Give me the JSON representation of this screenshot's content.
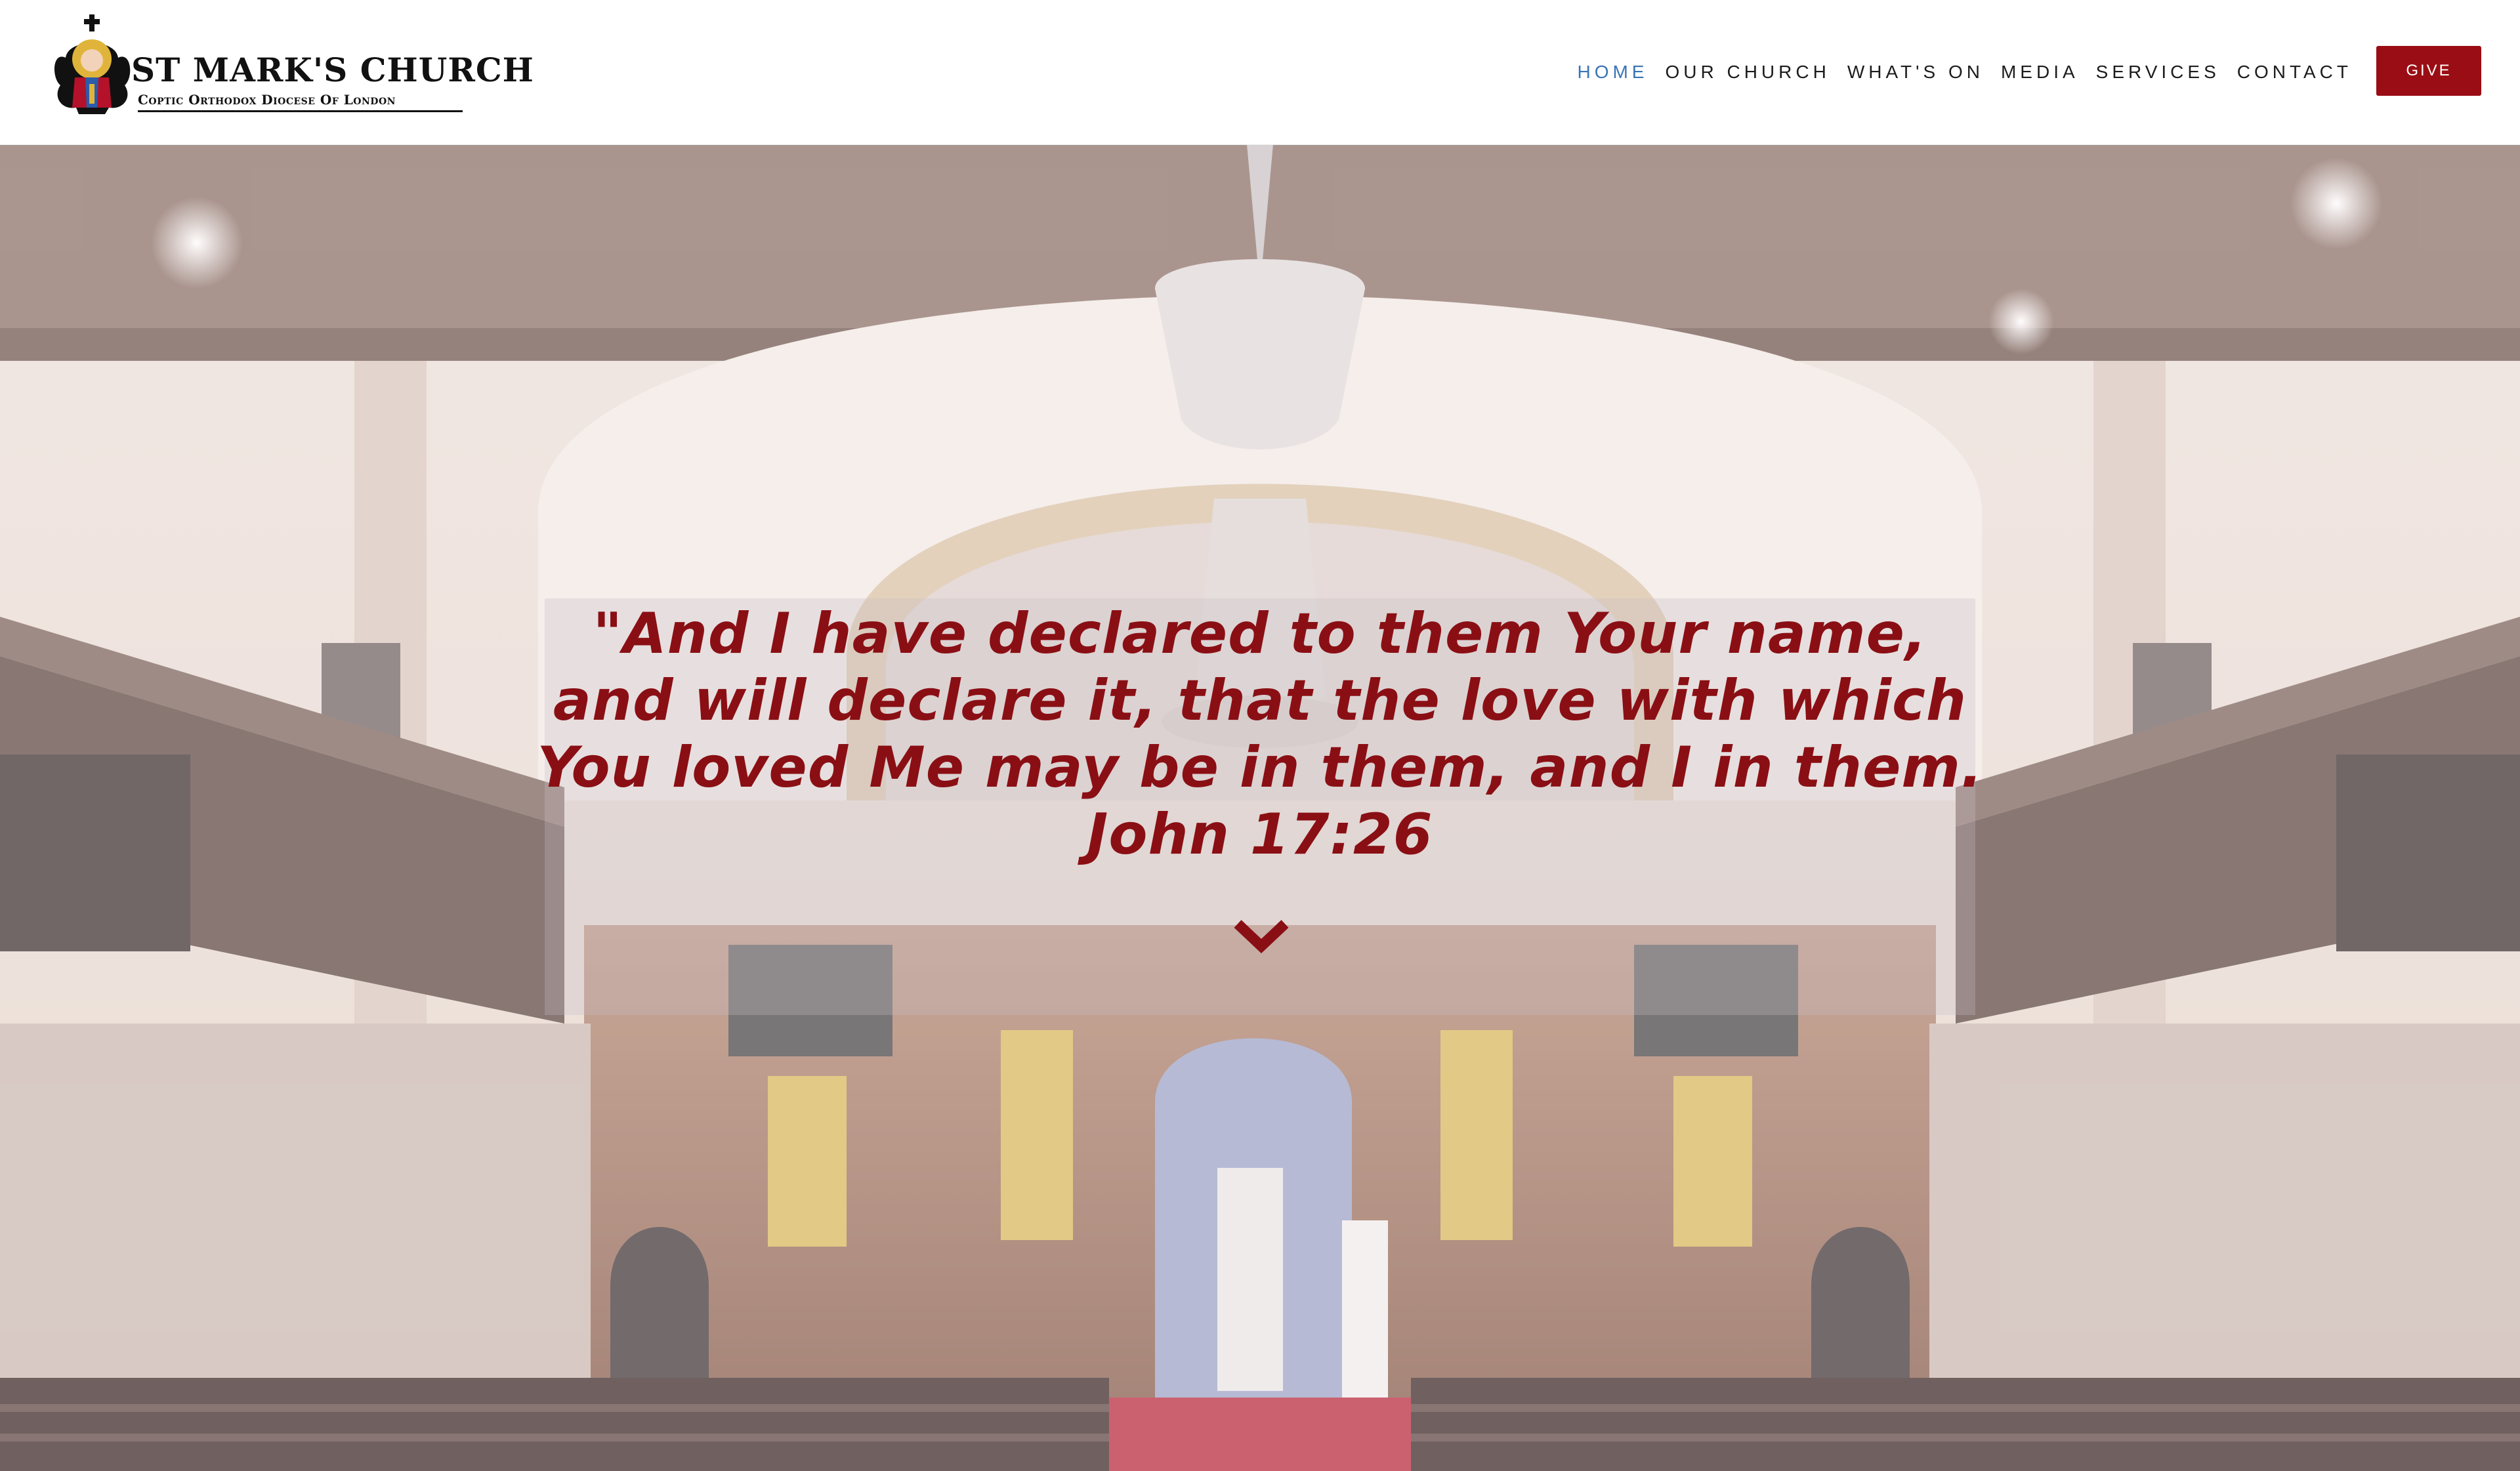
{
  "header": {
    "logo": {
      "title": "ST MARK'S CHURCH",
      "subtitle": "Coptic Orthodox Diocese Of London"
    },
    "nav": [
      {
        "label": "HOME",
        "active": true
      },
      {
        "label": "OUR CHURCH",
        "active": false
      },
      {
        "label": "WHAT'S ON",
        "active": false
      },
      {
        "label": "MEDIA",
        "active": false
      },
      {
        "label": "SERVICES",
        "active": false
      },
      {
        "label": "CONTACT",
        "active": false
      }
    ],
    "give_label": "GIVE"
  },
  "hero": {
    "background": "church-interior-photo",
    "quote_lines": [
      "\"And I have declared to them Your name,",
      "and will declare it, that the love with which",
      "You loved Me may be in them, and I in them.",
      "John 17:26"
    ],
    "scroll_icon": "chevron-down-icon"
  },
  "colors": {
    "accent_red": "#9b0d14",
    "quote_red": "#8a0f14",
    "nav_active": "#3a74b6",
    "nav_text": "#1c1c1c"
  }
}
